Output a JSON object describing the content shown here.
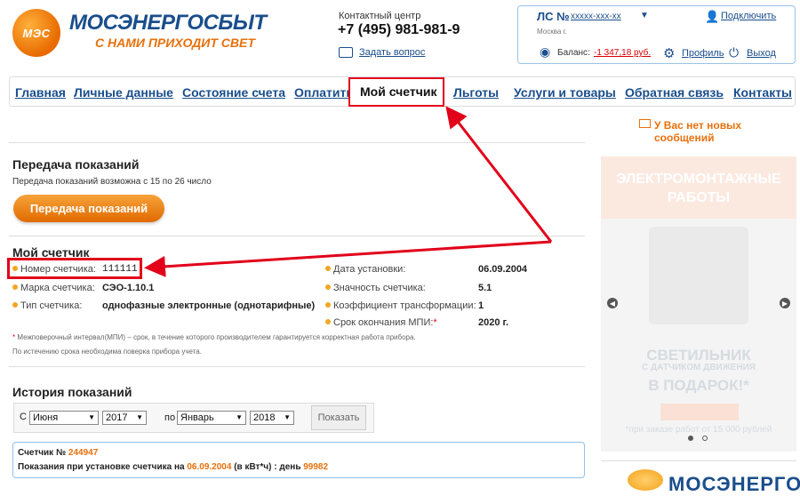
{
  "header": {
    "logo_mark": "МЭС",
    "logo_name": "МОСЭНЕРГОСБЫТ",
    "slogan": "С НАМИ ПРИХОДИТ СВЕТ",
    "contact_label": "Контактный центр",
    "phone": "+7 (495) 981-981-9",
    "ask_link": "Задать вопрос"
  },
  "account": {
    "ls_label": "ЛС №",
    "ls_value": "xxxxx-xxx-xx",
    "city": "Москва г.",
    "connect": "Подключить",
    "balance_label": "Баланс:",
    "balance_value": "-1 347,18 руб.",
    "profile": "Профиль",
    "logout": "Выход"
  },
  "nav": {
    "items": [
      "Главная",
      "Личные данные",
      "Состояние счета",
      "Оплатить",
      "Мой счетчик",
      "Льготы",
      "Услуги и товары",
      "Обратная связь",
      "Контакты"
    ],
    "active": "Мой счетчик"
  },
  "messages": "У Вас нет новых сообщений",
  "transfer": {
    "title": "Передача показаний",
    "note": "Передача показаний возможна с 15 по 26 число",
    "button": "Передача показаний"
  },
  "meter": {
    "title": "Мой счетчик",
    "left": [
      {
        "label": "Номер счетчика:",
        "value": "111111"
      },
      {
        "label": "Марка счетчика:",
        "value": "СЭО-1.10.1"
      },
      {
        "label": "Тип счетчика:",
        "value": "однофазные электронные (однотарифные)"
      }
    ],
    "right": [
      {
        "label": "Дата установки:",
        "value": "06.09.2004"
      },
      {
        "label": "Значность счетчика:",
        "value": "5.1"
      },
      {
        "label": "Коэффициент трансформации:",
        "value": "1"
      },
      {
        "label": "Срок окончания МПИ:",
        "value": "2020 г."
      }
    ],
    "note1": "Межповерочный интервал(МПИ) – срок, в течение которого производителем гарантируется корректная работа прибора.",
    "note2": "По истечению срока необходима поверка прибора учета."
  },
  "history": {
    "title": "История показаний",
    "from_label": "С",
    "from_month": "Июня",
    "from_year": "2017",
    "to_label": "по",
    "to_month": "Январь",
    "to_year": "2018",
    "show_button": "Показать",
    "counter_label": "Счетчик №",
    "counter_number": "244947",
    "reading_prefix": "Показания при установке счетчика на",
    "reading_date": "06.09.2004",
    "reading_unit": "(в кВт*ч) : день",
    "reading_value": "99982"
  },
  "banner": {
    "top_text": "ЭЛЕКТРОМОНТАЖНЫЕ РАБОТЫ",
    "title": "СВЕТИЛЬНИК",
    "subtitle": "С ДАТЧИКОМ ДВИЖЕНИЯ",
    "gift": "В ПОДАРОК!*",
    "note": "*при заказе работ от 15 000 рублей"
  },
  "footer_logo": "МОСЭНЕРГО"
}
